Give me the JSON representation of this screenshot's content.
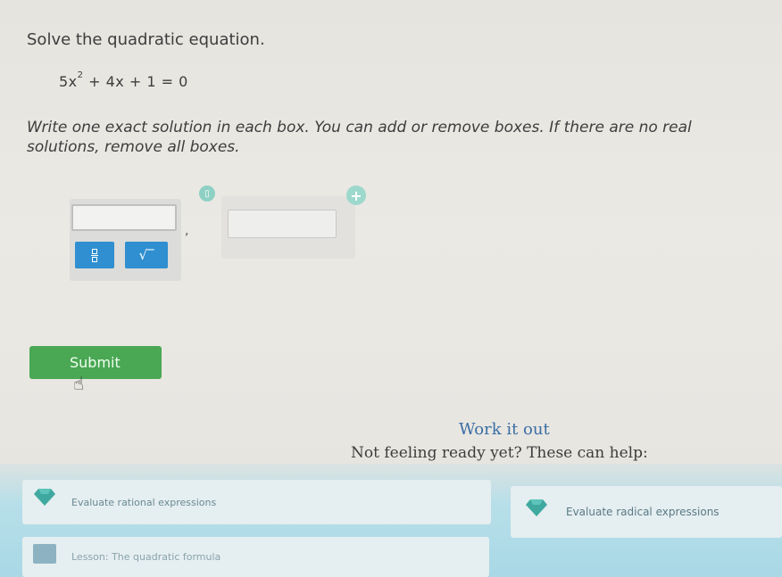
{
  "question": {
    "title": "Solve the quadratic equation.",
    "equation_base": "5x",
    "equation_exponent": "2",
    "equation_rest": " + 4x + 1 = 0",
    "instructions": "Write one exact solution in each box. You can add or remove boxes. If there are no real solutions, remove all boxes."
  },
  "answers": {
    "separator": ",",
    "box1_value": "",
    "box2_value": ""
  },
  "tools": {
    "sqrt_label": "√‾"
  },
  "submit": {
    "label": "Submit"
  },
  "help": {
    "work_link": "Work it out",
    "prompt": "Not feeling ready yet? These can help:",
    "cards": [
      {
        "label": "Evaluate rational expressions",
        "icon": "gem-icon"
      },
      {
        "label": "Evaluate radical expressions",
        "icon": "gem-icon"
      },
      {
        "label": "Lesson: The quadratic formula",
        "icon": "book-icon"
      }
    ]
  },
  "colors": {
    "submit_green": "#4aa754",
    "tool_blue": "#2f8fd0",
    "link_blue": "#3a6ea5",
    "help_band": "#b7dfe9"
  }
}
